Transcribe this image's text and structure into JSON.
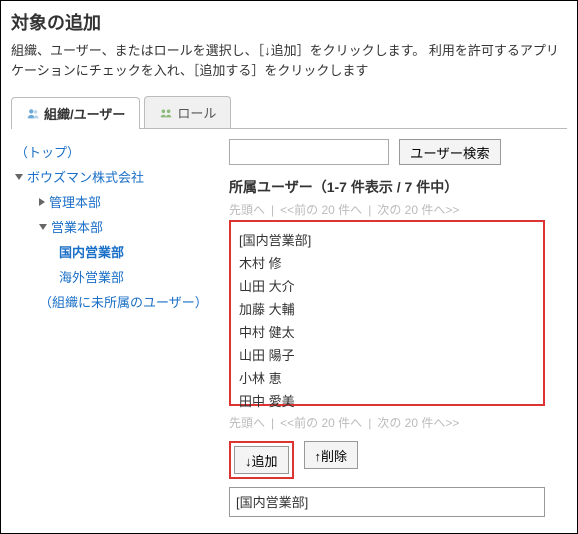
{
  "title": "対象の追加",
  "description": "組織、ユーザー、またはロールを選択し、［↓追加］をクリックします。\n利用を許可するアプリケーションにチェックを入れ、［追加する］をクリックします",
  "tabs": {
    "org_user": "組織/ユーザー",
    "role": "ロール"
  },
  "tree": {
    "top": "（トップ）",
    "org": "ボウズマン株式会社",
    "admin": "管理本部",
    "sales": "営業本部",
    "domestic": "国内営業部",
    "overseas": "海外営業部",
    "unassigned": "（組織に未所属のユーザー）"
  },
  "search": {
    "placeholder": "",
    "button": "ユーザー検索"
  },
  "section_title": "所属ユーザー（1-7 件表示 / 7 件中）",
  "pager": {
    "top": "先頭へ",
    "prev": "<<前の 20 件へ",
    "next": "次の 20 件へ>>"
  },
  "userlist": [
    "[国内営業部]",
    "木村  修",
    "山田  大介",
    "加藤  大輔",
    "中村  健太",
    "山田  陽子",
    "小林  恵",
    "田中  愛美"
  ],
  "actions": {
    "add": "↓追加",
    "remove": "↑削除"
  },
  "selected_item": "[国内営業部]"
}
